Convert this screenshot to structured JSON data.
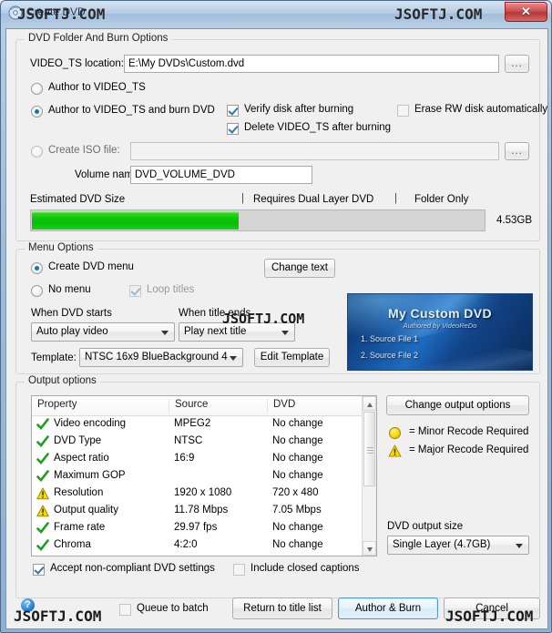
{
  "window": {
    "title": "Create DVD",
    "close_label": "✕",
    "app_icon": "disc-icon"
  },
  "watermarks": {
    "text": "JSOFTJ.COM",
    "instances": [
      "title-left",
      "title-right",
      "center",
      "bottom-left",
      "bottom-right"
    ]
  },
  "burn_options": {
    "group_title": "DVD Folder And Burn Options",
    "video_ts_label": "VIDEO_TS location:",
    "video_ts_value": "E:\\My DVDs\\Custom.dvd",
    "browse_label": "...",
    "radio_author_only": "Author to VIDEO_TS",
    "radio_author_burn": "Author to VIDEO_TS and burn DVD",
    "radio_create_iso": "Create ISO file:",
    "selected_radio": "author_burn",
    "iso_path_value": "",
    "iso_browse_label": "...",
    "volume_name_label": "Volume name:",
    "volume_name_value": "DVD_VOLUME_DVD",
    "check_verify": "Verify disk after burning",
    "check_verify_on": true,
    "check_delete": "Delete VIDEO_TS after burning",
    "check_delete_on": true,
    "check_erase": "Erase RW disk automatically",
    "check_erase_on": false
  },
  "size_meter": {
    "label": "Estimated DVD Size",
    "mark_dual_layer": "Requires Dual Layer DVD",
    "mark_folder_only": "Folder Only",
    "value_text": "4.53GB",
    "fill_percent": 46
  },
  "menu_options": {
    "group_title": "Menu Options",
    "radio_create_menu": "Create DVD menu",
    "radio_no_menu": "No menu",
    "selected_radio": "create_menu",
    "check_loop_titles": "Loop titles",
    "check_loop_titles_on": true,
    "check_loop_titles_enabled": false,
    "change_text_button": "Change text",
    "when_dvd_starts_label": "When DVD starts",
    "when_dvd_starts_value": "Auto play video",
    "when_title_ends_label": "When title ends",
    "when_title_ends_value": "Play next title",
    "template_label": "Template:",
    "template_value": "NTSC 16x9 BlueBackground 4",
    "edit_template_button": "Edit Template"
  },
  "preview": {
    "title": "My Custom DVD",
    "subtitle": "Authored by VideoReDo",
    "items": [
      "1. Source File 1",
      "2. Source File 2"
    ]
  },
  "output_options": {
    "group_title": "Output options",
    "columns": [
      "Property",
      "Source",
      "DVD"
    ],
    "rows": [
      {
        "status": "ok",
        "property": "Video encoding",
        "source": "MPEG2",
        "dvd": "No change"
      },
      {
        "status": "ok",
        "property": "DVD Type",
        "source": "NTSC",
        "dvd": "No change"
      },
      {
        "status": "ok",
        "property": "Aspect ratio",
        "source": "16:9",
        "dvd": "No change"
      },
      {
        "status": "ok",
        "property": "Maximum GOP",
        "source": "",
        "dvd": "No change"
      },
      {
        "status": "warn",
        "property": "Resolution",
        "source": "1920 x 1080",
        "dvd": "720 x 480"
      },
      {
        "status": "warn",
        "property": "Output quality",
        "source": "11.78 Mbps",
        "dvd": "7.05 Mbps"
      },
      {
        "status": "ok",
        "property": "Frame rate",
        "source": "29.97 fps",
        "dvd": "No change"
      },
      {
        "status": "ok",
        "property": "Chroma",
        "source": "4:2:0",
        "dvd": "No change"
      }
    ],
    "change_output_button": "Change output options",
    "legend_minor": "= Minor Recode Required",
    "legend_major": "= Major Recode Required",
    "dvd_output_size_label": "DVD output size",
    "dvd_output_size_value": "Single Layer (4.7GB)",
    "check_accept": "Accept non-compliant DVD settings",
    "check_accept_on": true,
    "check_captions": "Include closed captions",
    "check_captions_on": false
  },
  "footer": {
    "help_label": "?",
    "check_queue": "Queue to batch",
    "check_queue_on": false,
    "return_button": "Return to title list",
    "author_burn_button": "Author & Burn",
    "cancel_button": "Cancel"
  },
  "colors": {
    "accent_blue": "#1d6fb8",
    "progress_green": "#07c40a",
    "warn_yellow": "#f5d400",
    "ok_green": "#1f9d1f",
    "close_red": "#cf4f4f"
  }
}
